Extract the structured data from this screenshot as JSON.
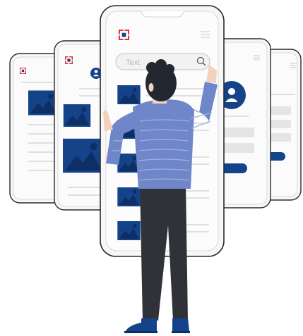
{
  "colors": {
    "brand_blue": "#14438a",
    "brand_red": "#e3252b",
    "phone_stroke": "#2b2b2b",
    "phone_fill": "#f7f7f7",
    "line": "#d9d9d9",
    "sweater": "#6f86c9",
    "sweater_stripe": "#9fb0e0",
    "pants": "#2f3237",
    "hair": "#232830",
    "skin": "#f3d2bd",
    "shoe": "#14438a"
  },
  "search": {
    "placeholder": "Text"
  },
  "icons": {
    "logo": "brand-logo-icon",
    "menu": "hamburger-menu-icon",
    "search": "search-icon",
    "user": "user-avatar-icon",
    "image": "image-placeholder-icon"
  }
}
